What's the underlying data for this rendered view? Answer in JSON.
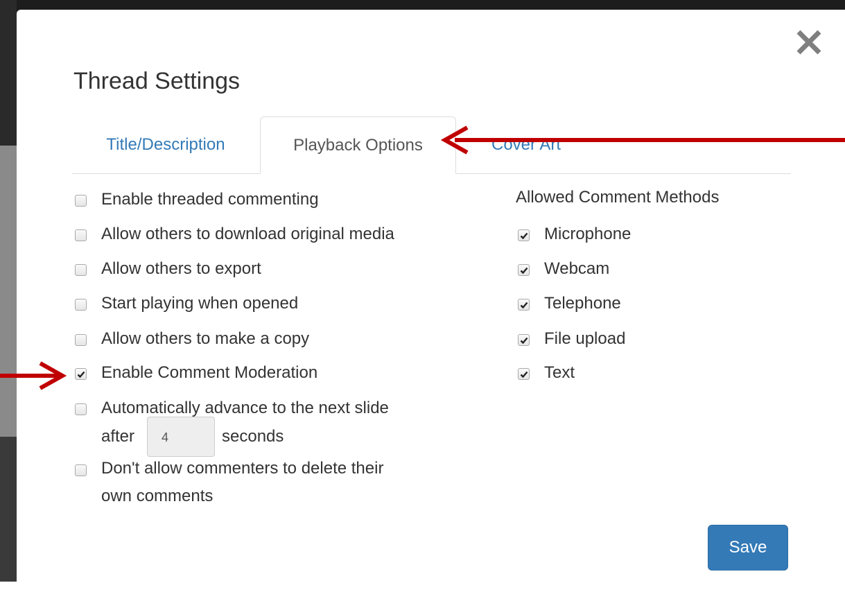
{
  "dialog": {
    "title": "Thread Settings",
    "close_icon": "close-icon"
  },
  "tabs": [
    {
      "label": "Title/Description",
      "active": false
    },
    {
      "label": "Playback Options",
      "active": true
    },
    {
      "label": "Cover Art",
      "active": false
    }
  ],
  "options": [
    {
      "label": "Enable threaded commenting",
      "checked": false
    },
    {
      "label": "Allow others to download original media",
      "checked": false
    },
    {
      "label": "Allow others to export",
      "checked": false
    },
    {
      "label": "Start playing when opened",
      "checked": false
    },
    {
      "label": "Allow others to make a copy",
      "checked": false
    },
    {
      "label": "Enable Comment Moderation",
      "checked": true
    },
    {
      "label": "Automatically advance to the next slide",
      "checked": false,
      "after": "after",
      "value": "4",
      "suffix": "seconds"
    },
    {
      "label": "Don't allow commenters to delete their",
      "line2": "own comments",
      "checked": false
    }
  ],
  "comment_methods": {
    "heading": "Allowed Comment Methods",
    "items": [
      {
        "label": "Microphone",
        "checked": true
      },
      {
        "label": "Webcam",
        "checked": true
      },
      {
        "label": "Telephone",
        "checked": true
      },
      {
        "label": "File upload",
        "checked": true
      },
      {
        "label": "Text",
        "checked": true
      }
    ]
  },
  "footer": {
    "save_label": "Save"
  },
  "annotations": {
    "arrow_color": "#c00000"
  }
}
